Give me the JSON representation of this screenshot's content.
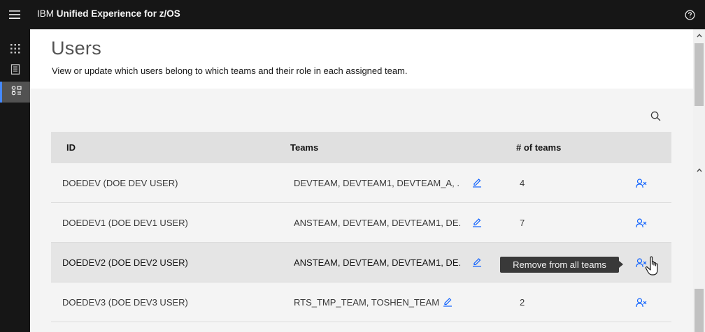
{
  "app": {
    "title_prefix": "IBM ",
    "title_main": "Unified Experience for z/OS"
  },
  "page": {
    "title": "Users",
    "description": "View or update which users belong to which teams and their role in each assigned team."
  },
  "table": {
    "headers": {
      "id": "ID",
      "teams": "Teams",
      "count": "# of teams"
    },
    "rows": [
      {
        "id": "DOEDEV (DOE DEV USER)",
        "teams": "DEVTEAM, DEVTEAM1, DEVTEAM_A, ...",
        "count": "4"
      },
      {
        "id": "DOEDEV1 (DOE DEV1 USER)",
        "teams": "ANSTEAM, DEVTEAM, DEVTEAM1, DE...",
        "count": "7"
      },
      {
        "id": "DOEDEV2 (DOE DEV2 USER)",
        "teams": "ANSTEAM, DEVTEAM, DEVTEAM1, DE...",
        "count": ""
      },
      {
        "id": "DOEDEV3 (DOE DEV3 USER)",
        "teams": "RTS_TMP_TEAM, TOSHEN_TEAM",
        "count": "2"
      }
    ]
  },
  "tooltip": {
    "text": "Remove from all teams"
  },
  "icons": {
    "menu": "hamburger-menu-icon",
    "help": "help-icon",
    "apps": "app-grid-icon",
    "catalog": "catalog-icon",
    "users": "user-groups-icon",
    "search": "search-icon",
    "edit": "edit-icon",
    "remove": "user-remove-icon"
  },
  "colors": {
    "topbar": "#161616",
    "accent": "#4589ff",
    "link": "#0f62fe"
  }
}
